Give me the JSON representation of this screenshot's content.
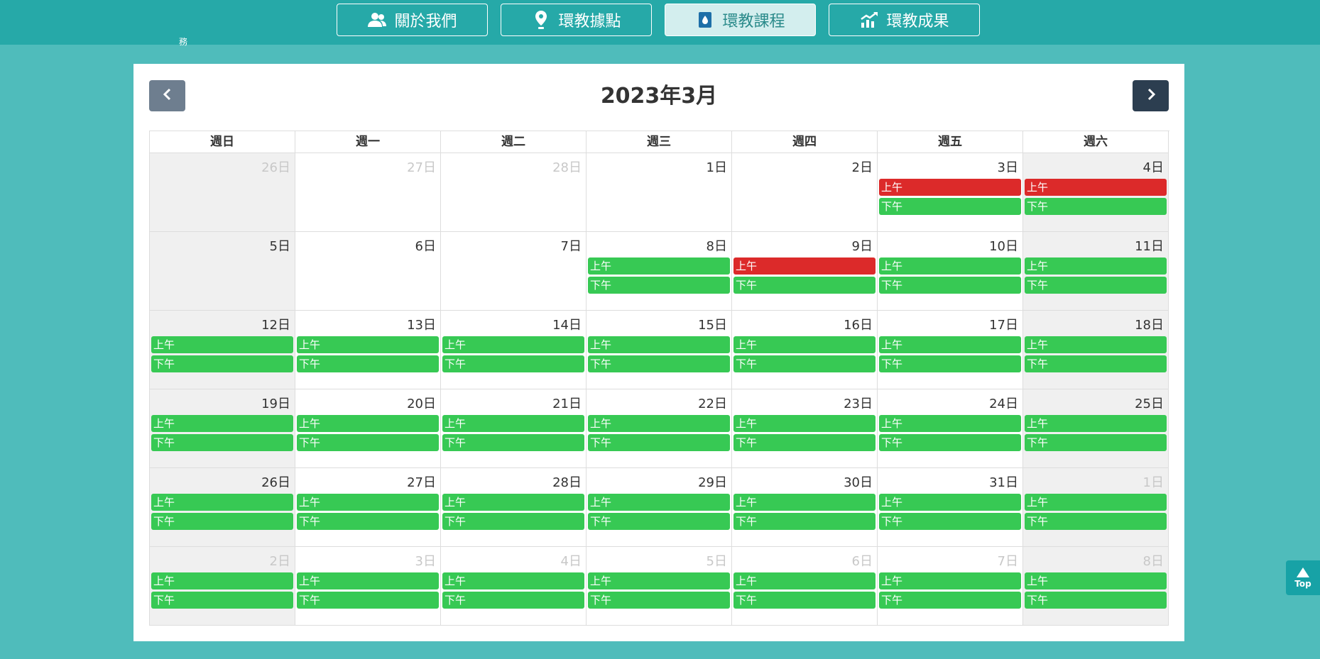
{
  "nav": {
    "items": [
      {
        "label": "關於我們",
        "icon": "users-icon",
        "active": false
      },
      {
        "label": "環教據點",
        "icon": "map-pin-icon",
        "active": false
      },
      {
        "label": "環教課程",
        "icon": "book-drop-icon",
        "active": true
      },
      {
        "label": "環教成果",
        "icon": "chart-growth-icon",
        "active": false
      }
    ]
  },
  "stray_text": "務",
  "calendar": {
    "title": "2023年3月",
    "prev_icon": "chevron-left-icon",
    "next_icon": "chevron-right-icon",
    "weekdays": [
      "週日",
      "週一",
      "週二",
      "週三",
      "週四",
      "週五",
      "週六"
    ],
    "weeks": [
      [
        {
          "label": "26日",
          "other": true,
          "events": []
        },
        {
          "label": "27日",
          "other": true,
          "events": []
        },
        {
          "label": "28日",
          "other": true,
          "events": []
        },
        {
          "label": "1日",
          "other": false,
          "events": []
        },
        {
          "label": "2日",
          "other": false,
          "events": []
        },
        {
          "label": "3日",
          "other": false,
          "events": [
            {
              "label": "上午",
              "status": "full"
            },
            {
              "label": "下午",
              "status": "open"
            }
          ]
        },
        {
          "label": "4日",
          "other": false,
          "events": [
            {
              "label": "上午",
              "status": "full"
            },
            {
              "label": "下午",
              "status": "open"
            }
          ]
        }
      ],
      [
        {
          "label": "5日",
          "other": false,
          "events": []
        },
        {
          "label": "6日",
          "other": false,
          "events": []
        },
        {
          "label": "7日",
          "other": false,
          "events": []
        },
        {
          "label": "8日",
          "other": false,
          "events": [
            {
              "label": "上午",
              "status": "open"
            },
            {
              "label": "下午",
              "status": "open"
            }
          ]
        },
        {
          "label": "9日",
          "other": false,
          "events": [
            {
              "label": "上午",
              "status": "full"
            },
            {
              "label": "下午",
              "status": "open"
            }
          ]
        },
        {
          "label": "10日",
          "other": false,
          "events": [
            {
              "label": "上午",
              "status": "open"
            },
            {
              "label": "下午",
              "status": "open"
            }
          ]
        },
        {
          "label": "11日",
          "other": false,
          "events": [
            {
              "label": "上午",
              "status": "open"
            },
            {
              "label": "下午",
              "status": "open"
            }
          ]
        }
      ],
      [
        {
          "label": "12日",
          "other": false,
          "events": [
            {
              "label": "上午",
              "status": "open"
            },
            {
              "label": "下午",
              "status": "open"
            }
          ]
        },
        {
          "label": "13日",
          "other": false,
          "events": [
            {
              "label": "上午",
              "status": "open"
            },
            {
              "label": "下午",
              "status": "open"
            }
          ]
        },
        {
          "label": "14日",
          "other": false,
          "events": [
            {
              "label": "上午",
              "status": "open"
            },
            {
              "label": "下午",
              "status": "open"
            }
          ]
        },
        {
          "label": "15日",
          "other": false,
          "events": [
            {
              "label": "上午",
              "status": "open"
            },
            {
              "label": "下午",
              "status": "open"
            }
          ]
        },
        {
          "label": "16日",
          "other": false,
          "events": [
            {
              "label": "上午",
              "status": "open"
            },
            {
              "label": "下午",
              "status": "open"
            }
          ]
        },
        {
          "label": "17日",
          "other": false,
          "events": [
            {
              "label": "上午",
              "status": "open"
            },
            {
              "label": "下午",
              "status": "open"
            }
          ]
        },
        {
          "label": "18日",
          "other": false,
          "events": [
            {
              "label": "上午",
              "status": "open"
            },
            {
              "label": "下午",
              "status": "open"
            }
          ]
        }
      ],
      [
        {
          "label": "19日",
          "other": false,
          "events": [
            {
              "label": "上午",
              "status": "open"
            },
            {
              "label": "下午",
              "status": "open"
            }
          ]
        },
        {
          "label": "20日",
          "other": false,
          "events": [
            {
              "label": "上午",
              "status": "open"
            },
            {
              "label": "下午",
              "status": "open"
            }
          ]
        },
        {
          "label": "21日",
          "other": false,
          "events": [
            {
              "label": "上午",
              "status": "open"
            },
            {
              "label": "下午",
              "status": "open"
            }
          ]
        },
        {
          "label": "22日",
          "other": false,
          "events": [
            {
              "label": "上午",
              "status": "open"
            },
            {
              "label": "下午",
              "status": "open"
            }
          ]
        },
        {
          "label": "23日",
          "other": false,
          "events": [
            {
              "label": "上午",
              "status": "open"
            },
            {
              "label": "下午",
              "status": "open"
            }
          ]
        },
        {
          "label": "24日",
          "other": false,
          "events": [
            {
              "label": "上午",
              "status": "open"
            },
            {
              "label": "下午",
              "status": "open"
            }
          ]
        },
        {
          "label": "25日",
          "other": false,
          "events": [
            {
              "label": "上午",
              "status": "open"
            },
            {
              "label": "下午",
              "status": "open"
            }
          ]
        }
      ],
      [
        {
          "label": "26日",
          "other": false,
          "events": [
            {
              "label": "上午",
              "status": "open"
            },
            {
              "label": "下午",
              "status": "open"
            }
          ]
        },
        {
          "label": "27日",
          "other": false,
          "events": [
            {
              "label": "上午",
              "status": "open"
            },
            {
              "label": "下午",
              "status": "open"
            }
          ]
        },
        {
          "label": "28日",
          "other": false,
          "events": [
            {
              "label": "上午",
              "status": "open"
            },
            {
              "label": "下午",
              "status": "open"
            }
          ]
        },
        {
          "label": "29日",
          "other": false,
          "events": [
            {
              "label": "上午",
              "status": "open"
            },
            {
              "label": "下午",
              "status": "open"
            }
          ]
        },
        {
          "label": "30日",
          "other": false,
          "events": [
            {
              "label": "上午",
              "status": "open"
            },
            {
              "label": "下午",
              "status": "open"
            }
          ]
        },
        {
          "label": "31日",
          "other": false,
          "events": [
            {
              "label": "上午",
              "status": "open"
            },
            {
              "label": "下午",
              "status": "open"
            }
          ]
        },
        {
          "label": "1日",
          "other": true,
          "events": [
            {
              "label": "上午",
              "status": "open"
            },
            {
              "label": "下午",
              "status": "open"
            }
          ]
        }
      ],
      [
        {
          "label": "2日",
          "other": true,
          "events": [
            {
              "label": "上午",
              "status": "open"
            },
            {
              "label": "下午",
              "status": "open"
            }
          ]
        },
        {
          "label": "3日",
          "other": true,
          "events": [
            {
              "label": "上午",
              "status": "open"
            },
            {
              "label": "下午",
              "status": "open"
            }
          ]
        },
        {
          "label": "4日",
          "other": true,
          "events": [
            {
              "label": "上午",
              "status": "open"
            },
            {
              "label": "下午",
              "status": "open"
            }
          ]
        },
        {
          "label": "5日",
          "other": true,
          "events": [
            {
              "label": "上午",
              "status": "open"
            },
            {
              "label": "下午",
              "status": "open"
            }
          ]
        },
        {
          "label": "6日",
          "other": true,
          "events": [
            {
              "label": "上午",
              "status": "open"
            },
            {
              "label": "下午",
              "status": "open"
            }
          ]
        },
        {
          "label": "7日",
          "other": true,
          "events": [
            {
              "label": "上午",
              "status": "open"
            },
            {
              "label": "下午",
              "status": "open"
            }
          ]
        },
        {
          "label": "8日",
          "other": true,
          "events": [
            {
              "label": "上午",
              "status": "open"
            },
            {
              "label": "下午",
              "status": "open"
            }
          ]
        }
      ]
    ]
  },
  "colors": {
    "background": "#4fbcbb",
    "header": "#26a9a8",
    "event_open": "#37c954",
    "event_full": "#dc2a2a",
    "weekend_cell": "#f0f0f0"
  },
  "scroll_top": {
    "label": "Top",
    "icon": "arrow-up-icon"
  }
}
